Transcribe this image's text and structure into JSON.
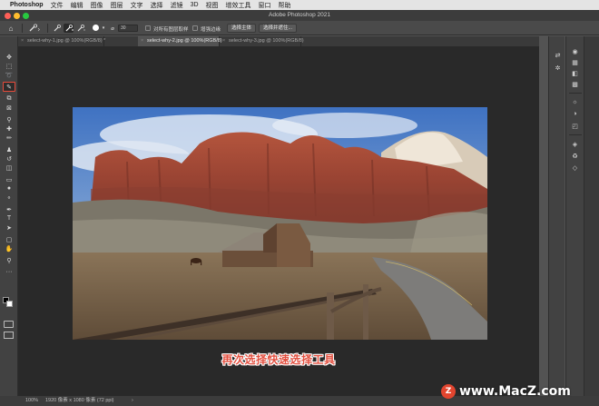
{
  "menubar": {
    "apple": "",
    "app_name": "Photoshop",
    "items": [
      "文件",
      "编辑",
      "图像",
      "图层",
      "文字",
      "选择",
      "滤镜",
      "3D",
      "视图",
      "增效工具",
      "窗口",
      "帮助"
    ]
  },
  "window": {
    "title": "Adobe Photoshop 2021"
  },
  "options": {
    "brush_size": "30",
    "sample_all_layers": "对所有图层取样",
    "enhance_edge": "增强边缘",
    "select_subject": "选择主体",
    "select_and_mask": "选择并遮住..."
  },
  "tabs": [
    {
      "label": "select-why-1.jpg @ 100%(RGB/8) *",
      "close": "×"
    },
    {
      "label": "select-why-2.jpg @ 100%(RGB/8)",
      "close": "×"
    },
    {
      "label": "select-why-3.jpg @ 100%(RGB/8)",
      "close": "×"
    }
  ],
  "active_tab": 1,
  "tools": [
    {
      "name": "move-tool",
      "icon": "✥"
    },
    {
      "name": "marquee-tool",
      "icon": "⬚"
    },
    {
      "name": "lasso-tool",
      "icon": "➰"
    },
    {
      "name": "quick-selection-tool",
      "icon": "✎",
      "selected": true
    },
    {
      "name": "crop-tool",
      "icon": "⧉"
    },
    {
      "name": "frame-tool",
      "icon": "⊠"
    },
    {
      "name": "eyedropper-tool",
      "icon": "⚲"
    },
    {
      "name": "healing-brush-tool",
      "icon": "✚"
    },
    {
      "name": "brush-tool",
      "icon": "✏"
    },
    {
      "name": "clone-stamp-tool",
      "icon": "♟"
    },
    {
      "name": "history-brush-tool",
      "icon": "↺"
    },
    {
      "name": "eraser-tool",
      "icon": "◫"
    },
    {
      "name": "gradient-tool",
      "icon": "▭"
    },
    {
      "name": "blur-tool",
      "icon": "●"
    },
    {
      "name": "dodge-tool",
      "icon": "⚬"
    },
    {
      "name": "pen-tool",
      "icon": "✒"
    },
    {
      "name": "type-tool",
      "icon": "T"
    },
    {
      "name": "path-selection-tool",
      "icon": "➤"
    },
    {
      "name": "rectangle-tool",
      "icon": "▢"
    },
    {
      "name": "hand-tool",
      "icon": "✋"
    },
    {
      "name": "zoom-tool",
      "icon": "⚲"
    },
    {
      "name": "more-tools",
      "icon": "···"
    }
  ],
  "caption": "再次选择快速选择工具",
  "status": {
    "zoom": "100%",
    "doc_info": "1920 像素 x 1080 像素 (72 ppi)",
    "arrow": "›"
  },
  "watermark": {
    "logo": "Z",
    "text": "www.MacZ.com"
  },
  "colors": {
    "accent_red": "#e84a3a",
    "caption_red": "#e25040",
    "panel_bg": "#424242",
    "canvas_bg": "#292929",
    "close": "#ff5f57",
    "minimize": "#febc2e",
    "zoom": "#28c840"
  }
}
